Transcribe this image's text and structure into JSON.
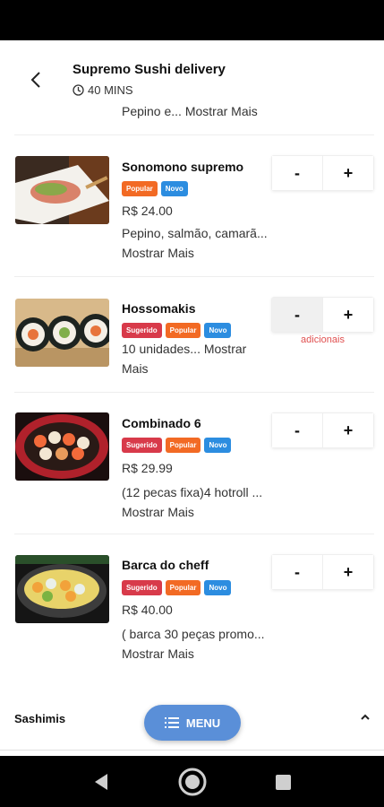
{
  "header": {
    "title": "Supremo Sushi delivery",
    "eta": "40 MINS"
  },
  "previous_item": {
    "desc_text": "Pepino e... ",
    "more": "Mostrar Mais"
  },
  "items": [
    {
      "name": "Sonomono supremo",
      "badges": [
        "Popular",
        "Novo"
      ],
      "price": "R$ 24.00",
      "desc_text": "Pepino, salmão, camarã... ",
      "more": "Mostrar Mais",
      "minus": "-",
      "plus": "+"
    },
    {
      "name": "Hossomakis",
      "badges": [
        "Sugerido",
        "Popular",
        "Novo"
      ],
      "price": "",
      "desc_text": "10 unidades... ",
      "more": "Mostrar Mais",
      "minus": "-",
      "plus": "+",
      "note": "adicionais"
    },
    {
      "name": "Combinado 6",
      "badges": [
        "Sugerido",
        "Popular",
        "Novo"
      ],
      "price": "R$ 29.99",
      "desc_text": "(12 pecas fixa)4 hotroll ... ",
      "more": "Mostrar Mais",
      "minus": "-",
      "plus": "+"
    },
    {
      "name": "Barca do cheff",
      "badges": [
        "Sugerido",
        "Popular",
        "Novo"
      ],
      "price": "R$ 40.00",
      "desc_text": "( barca 30 peças promo... ",
      "more": "Mostrar Mais",
      "minus": "-",
      "plus": "+"
    }
  ],
  "section": {
    "title": "Sashimis"
  },
  "fab": {
    "label": "MENU",
    "icon": "list-icon"
  },
  "colors": {
    "badge_sugerido": "#d83a4a",
    "badge_popular": "#f26a24",
    "badge_novo": "#2c8de0",
    "fab": "#5a8fd8",
    "note": "#e05050"
  }
}
